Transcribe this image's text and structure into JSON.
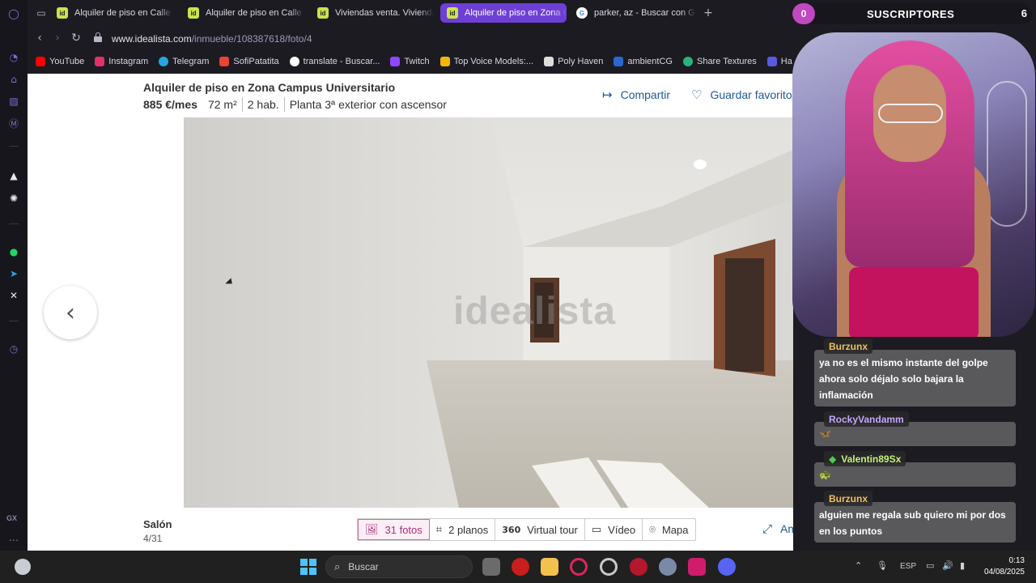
{
  "tabs": [
    {
      "label": "Alquiler de piso en Calle A",
      "favicon": "idealista-icon",
      "active": false
    },
    {
      "label": "Alquiler de piso en Calle E",
      "favicon": "idealista-icon",
      "active": false
    },
    {
      "label": "Viviendas venta. Vivienda",
      "favicon": "idealista-icon",
      "active": false
    },
    {
      "label": "Alquiler de piso en Zona C",
      "favicon": "idealista-icon",
      "active": true
    },
    {
      "label": "parker, az - Buscar con G",
      "favicon": "google-icon",
      "active": false
    }
  ],
  "favicon_text": {
    "idealista": "id",
    "google": "G"
  },
  "new_tab": "+",
  "address": {
    "host": "www.idealista.com",
    "path": "/inmueble/108387618/foto/4"
  },
  "bookmarks": [
    {
      "label": "YouTube",
      "color": "#ff0000"
    },
    {
      "label": "Instagram",
      "color": "#e1306c"
    },
    {
      "label": "Telegram",
      "color": "#2aa3e0"
    },
    {
      "label": "SofiPatatita",
      "color": "#ea4335"
    },
    {
      "label": "translate - Buscar...",
      "color": "#ffffff"
    },
    {
      "label": "Twitch",
      "color": "#9146ff"
    },
    {
      "label": "Top Voice Models:...",
      "color": "#f2b705"
    },
    {
      "label": "Poly Haven",
      "color": "#dddddd"
    },
    {
      "label": "ambientCG",
      "color": "#2b67d1"
    },
    {
      "label": "Share Textures",
      "color": "#27b37d"
    },
    {
      "label": "Ha",
      "color": "#5a5ae0"
    }
  ],
  "listing": {
    "title": "Alquiler de piso en Zona Campus Universitario",
    "price": "885 €/mes",
    "size": "72 m²",
    "rooms": "2 hab.",
    "floor": "Planta 3ª exterior con ascensor",
    "share_label": "Compartir",
    "save_label": "Guardar favorito",
    "watermark": "idealista"
  },
  "photo": {
    "caption": "Salón",
    "counter": "4/31"
  },
  "media_tabs": [
    {
      "label": "31 fotos",
      "icon": "image-icon",
      "active": true
    },
    {
      "label": "2 planos",
      "icon": "floorplan-icon",
      "active": false
    },
    {
      "label": "Virtual tour",
      "icon": "360-icon",
      "active": false
    },
    {
      "label": "Vídeo",
      "icon": "video-icon",
      "active": false
    },
    {
      "label": "Mapa",
      "icon": "map-pin-icon",
      "active": false
    }
  ],
  "media_glyphs": {
    "image-icon": "🖼",
    "floorplan-icon": "⌗",
    "360-icon": "360",
    "video-icon": "▭",
    "map-pin-icon": "⌾"
  },
  "expand_label": "Ampliar",
  "stream": {
    "subscriber_prefix": "0",
    "subscriber_label": "SUSCRIPTORES",
    "subscriber_count": "6"
  },
  "chat": [
    {
      "user": "Burzunx",
      "user_color": "#f0c060",
      "text": "ya no es el mismo instante del golpe ahora solo déjalo solo bajara la inflamación"
    },
    {
      "user": "RockyVandamm",
      "user_color": "#c7a6ff",
      "text": "🦋"
    },
    {
      "user": "Valentin89Sx",
      "user_color": "#c8f27a",
      "text": "🐢",
      "badge": "◆"
    },
    {
      "user": "Burzunx",
      "user_color": "#f0c060",
      "text": "alguien me regala sub quiero mi por dos en los puntos"
    }
  ],
  "taskbar": {
    "search_placeholder": "Buscar",
    "language": "ESP",
    "time": "0:13",
    "date": "04/08/2025"
  },
  "sidebar_gx": "GX"
}
